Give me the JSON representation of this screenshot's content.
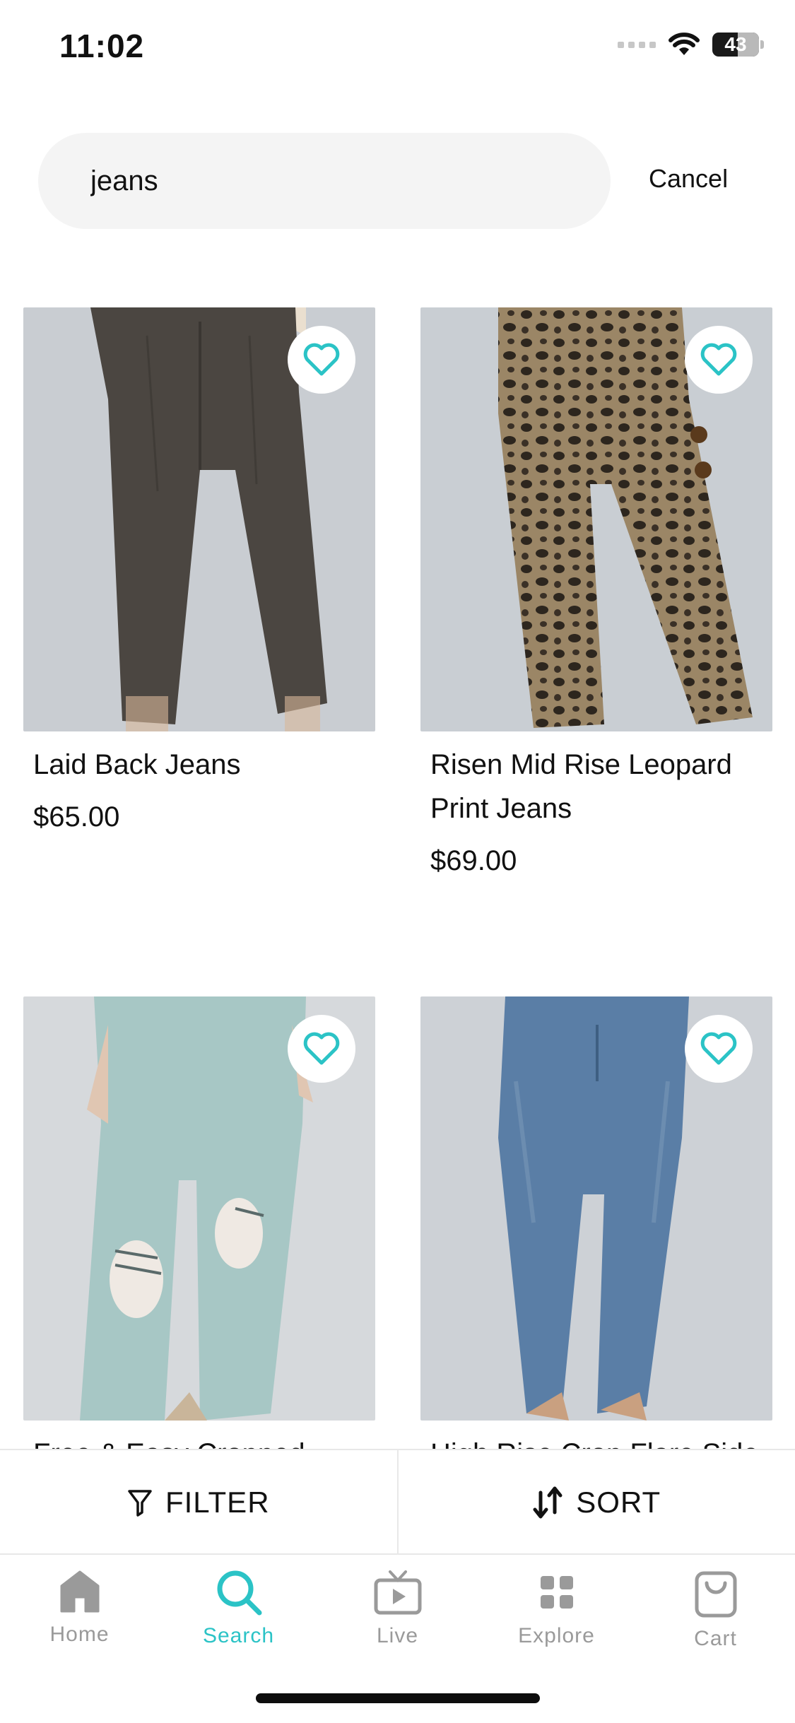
{
  "status_bar": {
    "time": "11:02",
    "battery": "43"
  },
  "search": {
    "query": "jeans",
    "cancel_label": "Cancel"
  },
  "products": [
    {
      "name": "Laid Back Jeans",
      "price": "$65.00"
    },
    {
      "name": "Risen Mid Rise Leopard Print Jeans",
      "price": "$69.00"
    },
    {
      "name": "Free & Easy Cropped",
      "price": ""
    },
    {
      "name": "High Rise Crop Flare Side",
      "price": ""
    }
  ],
  "actions": {
    "filter_label": "FILTER",
    "sort_label": "SORT"
  },
  "tabs": [
    {
      "label": "Home",
      "icon": "home-icon"
    },
    {
      "label": "Search",
      "icon": "search-icon"
    },
    {
      "label": "Live",
      "icon": "live-tv-icon"
    },
    {
      "label": "Explore",
      "icon": "grid-icon"
    },
    {
      "label": "Cart",
      "icon": "shopping-bag-icon"
    }
  ],
  "colors": {
    "accent": "#2bc3c6",
    "inactive": "#9a9a9a"
  }
}
